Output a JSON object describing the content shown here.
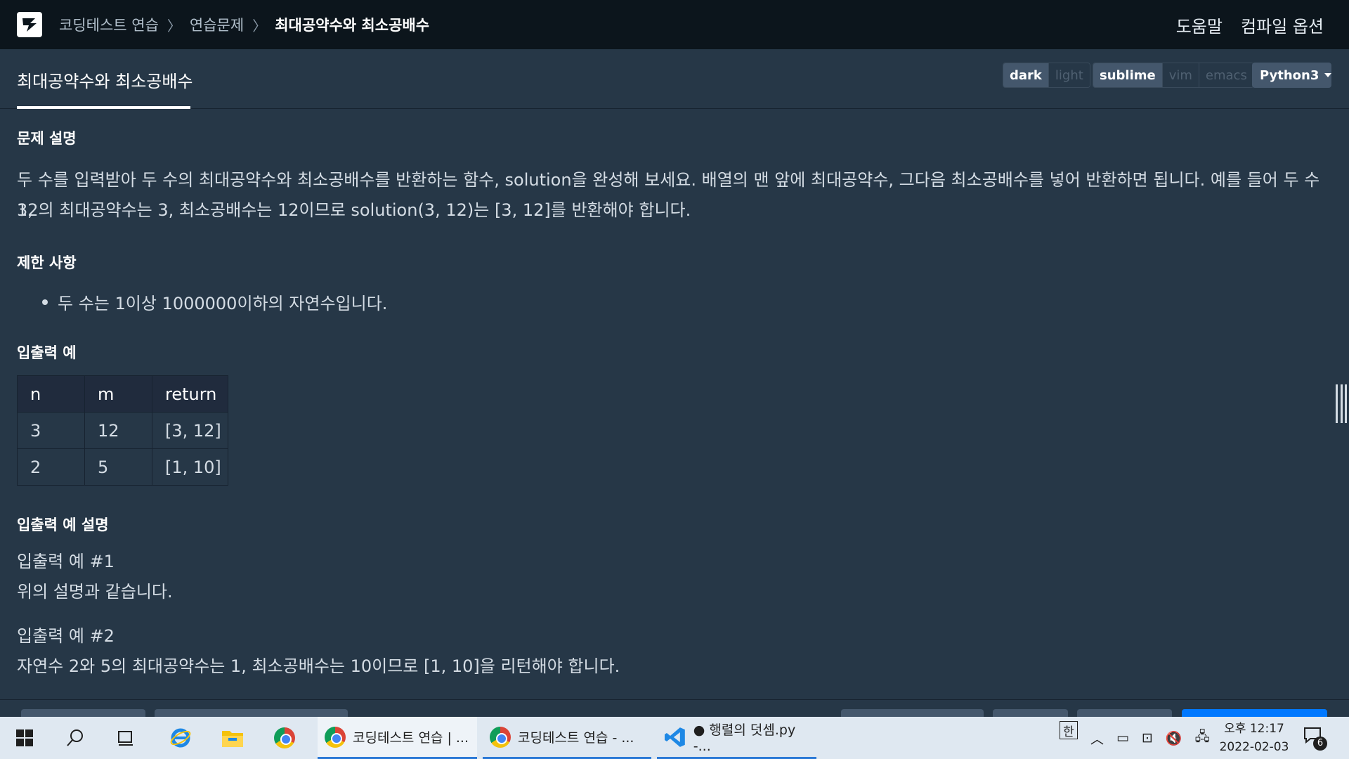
{
  "topnav": {
    "breadcrumb": [
      "코딩테스트 연습",
      "연습문제",
      "최대공약수와 최소공배수"
    ],
    "separator": "〉",
    "help": "도움말",
    "compile_options": "컴파일 옵션"
  },
  "header": {
    "title": "최대공약수와 최소공배수",
    "theme": {
      "dark": "dark",
      "light": "light",
      "selected": "dark"
    },
    "keymap": {
      "sublime": "sublime",
      "vim": "vim",
      "emacs": "emacs",
      "selected": "sublime"
    },
    "language": "Python3"
  },
  "problem": {
    "desc_heading": "문제 설명",
    "desc_line1": "두 수를 입력받아 두 수의 최대공약수와 최소공배수를 반환하는 함수, solution을 완성해 보세요. 배열의 맨 앞에 최대공약수, 그다음 최소공배수를 넣어 반환하면 됩니다. 예를 들어 두 수 3,",
    "desc_line2": "12의 최대공약수는 3, 최소공배수는 12이므로 solution(3, 12)는 [3, 12]를 반환해야 합니다.",
    "constraints_heading": "제한 사항",
    "constraints": [
      "두 수는 1이상 1000000이하의 자연수입니다."
    ],
    "io_heading": "입출력 예",
    "io_table": {
      "headers": [
        "n",
        "m",
        "return"
      ],
      "rows": [
        [
          "3",
          "12",
          "[3, 12]"
        ],
        [
          "2",
          "5",
          "[1, 10]"
        ]
      ]
    },
    "io_desc_heading": "입출력 예 설명",
    "ex1_title": "입출력 예 #1",
    "ex1_text": "위의 설명과 같습니다.",
    "ex2_title": "입출력 예 #2",
    "ex2_text": "자연수 2와 5의 최대공약수는 1, 최소공배수는 10이므로 [1, 10]을 리턴해야 합니다."
  },
  "taskbar": {
    "apps": [
      {
        "label": "코딩테스트 연습 | ...",
        "icon": "chrome-icon"
      },
      {
        "label": "코딩테스트 연습 - ...",
        "icon": "chrome-icon"
      },
      {
        "label": "● 행렬의 덧셈.py -...",
        "icon": "vscode-icon"
      }
    ],
    "ime": "한",
    "clock_time": "오후 12:17",
    "clock_date": "2022-02-03",
    "notifications": "6"
  }
}
